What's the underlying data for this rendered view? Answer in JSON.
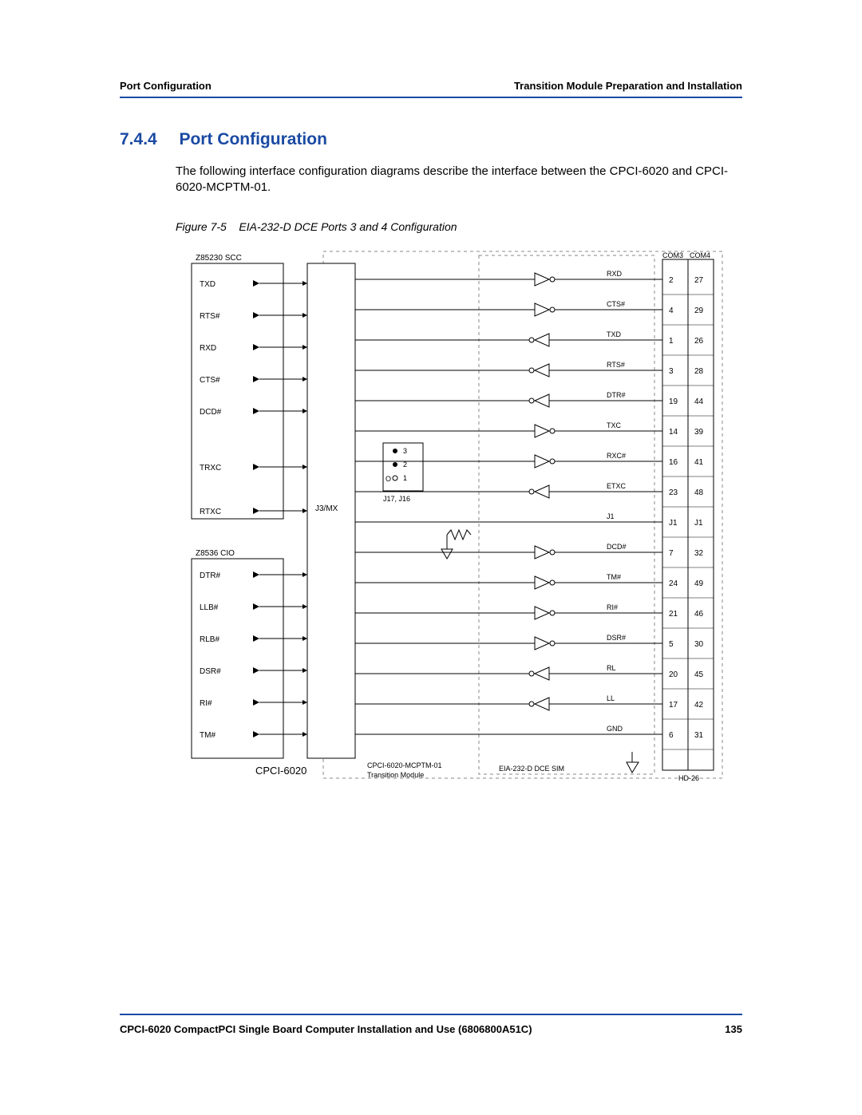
{
  "header": {
    "left": "Port Configuration",
    "right": "Transition Module Preparation and Installation"
  },
  "section": {
    "number": "7.4.4",
    "title": "Port Configuration",
    "body": "The following interface configuration diagrams describe the interface between the CPCI-6020 and CPCI-6020-MCPTM-01."
  },
  "figure": {
    "label": "Figure 7-5",
    "title": "EIA-232-D DCE Ports 3 and 4 Configuration"
  },
  "diagram": {
    "left_block1_label": "Z85230 SCC",
    "left_block2_label": "Z8536 CIO",
    "left_signals_a": [
      "TXD",
      "RTS#",
      "RXD",
      "CTS#",
      "DCD#",
      "TRXC",
      "RTXC"
    ],
    "left_signals_b": [
      "DTR#",
      "LLB#",
      "RLB#",
      "DSR#",
      "RI#",
      "TM#"
    ],
    "center_label": "J3/MX",
    "jumper_label": "J17, J16",
    "jumper_pins": [
      "3",
      "2",
      "1"
    ],
    "jumper_open": "O",
    "board_label": "CPCI-6020",
    "tm_label_1": "CPCI-6020-MCPTM-01",
    "tm_label_2": "Transition Module",
    "sim_label": "EIA-232-D DCE SIM",
    "conn_head_left": "COM3",
    "conn_head_right": "COM4",
    "conn_label": "HD-26",
    "right_signals": [
      {
        "name": "RXD",
        "l": "2",
        "r": "27"
      },
      {
        "name": "CTS#",
        "l": "4",
        "r": "29"
      },
      {
        "name": "TXD",
        "l": "1",
        "r": "26"
      },
      {
        "name": "RTS#",
        "l": "3",
        "r": "28"
      },
      {
        "name": "DTR#",
        "l": "19",
        "r": "44"
      },
      {
        "name": "TXC",
        "l": "14",
        "r": "39"
      },
      {
        "name": "RXC#",
        "l": "16",
        "r": "41"
      },
      {
        "name": "ETXC",
        "l": "23",
        "r": "48"
      },
      {
        "name": "J1",
        "l": "J1",
        "r": "J1"
      },
      {
        "name": "DCD#",
        "l": "7",
        "r": "32"
      },
      {
        "name": "TM#",
        "l": "24",
        "r": "49"
      },
      {
        "name": "RI#",
        "l": "21",
        "r": "46"
      },
      {
        "name": "DSR#",
        "l": "5",
        "r": "30"
      },
      {
        "name": "RL",
        "l": "20",
        "r": "45"
      },
      {
        "name": "LL",
        "l": "17",
        "r": "42"
      },
      {
        "name": "GND",
        "l": "6",
        "r": "31"
      }
    ]
  },
  "footer": {
    "left": "CPCI-6020 CompactPCI Single Board Computer Installation and Use (6806800A51C)",
    "page": "135"
  }
}
